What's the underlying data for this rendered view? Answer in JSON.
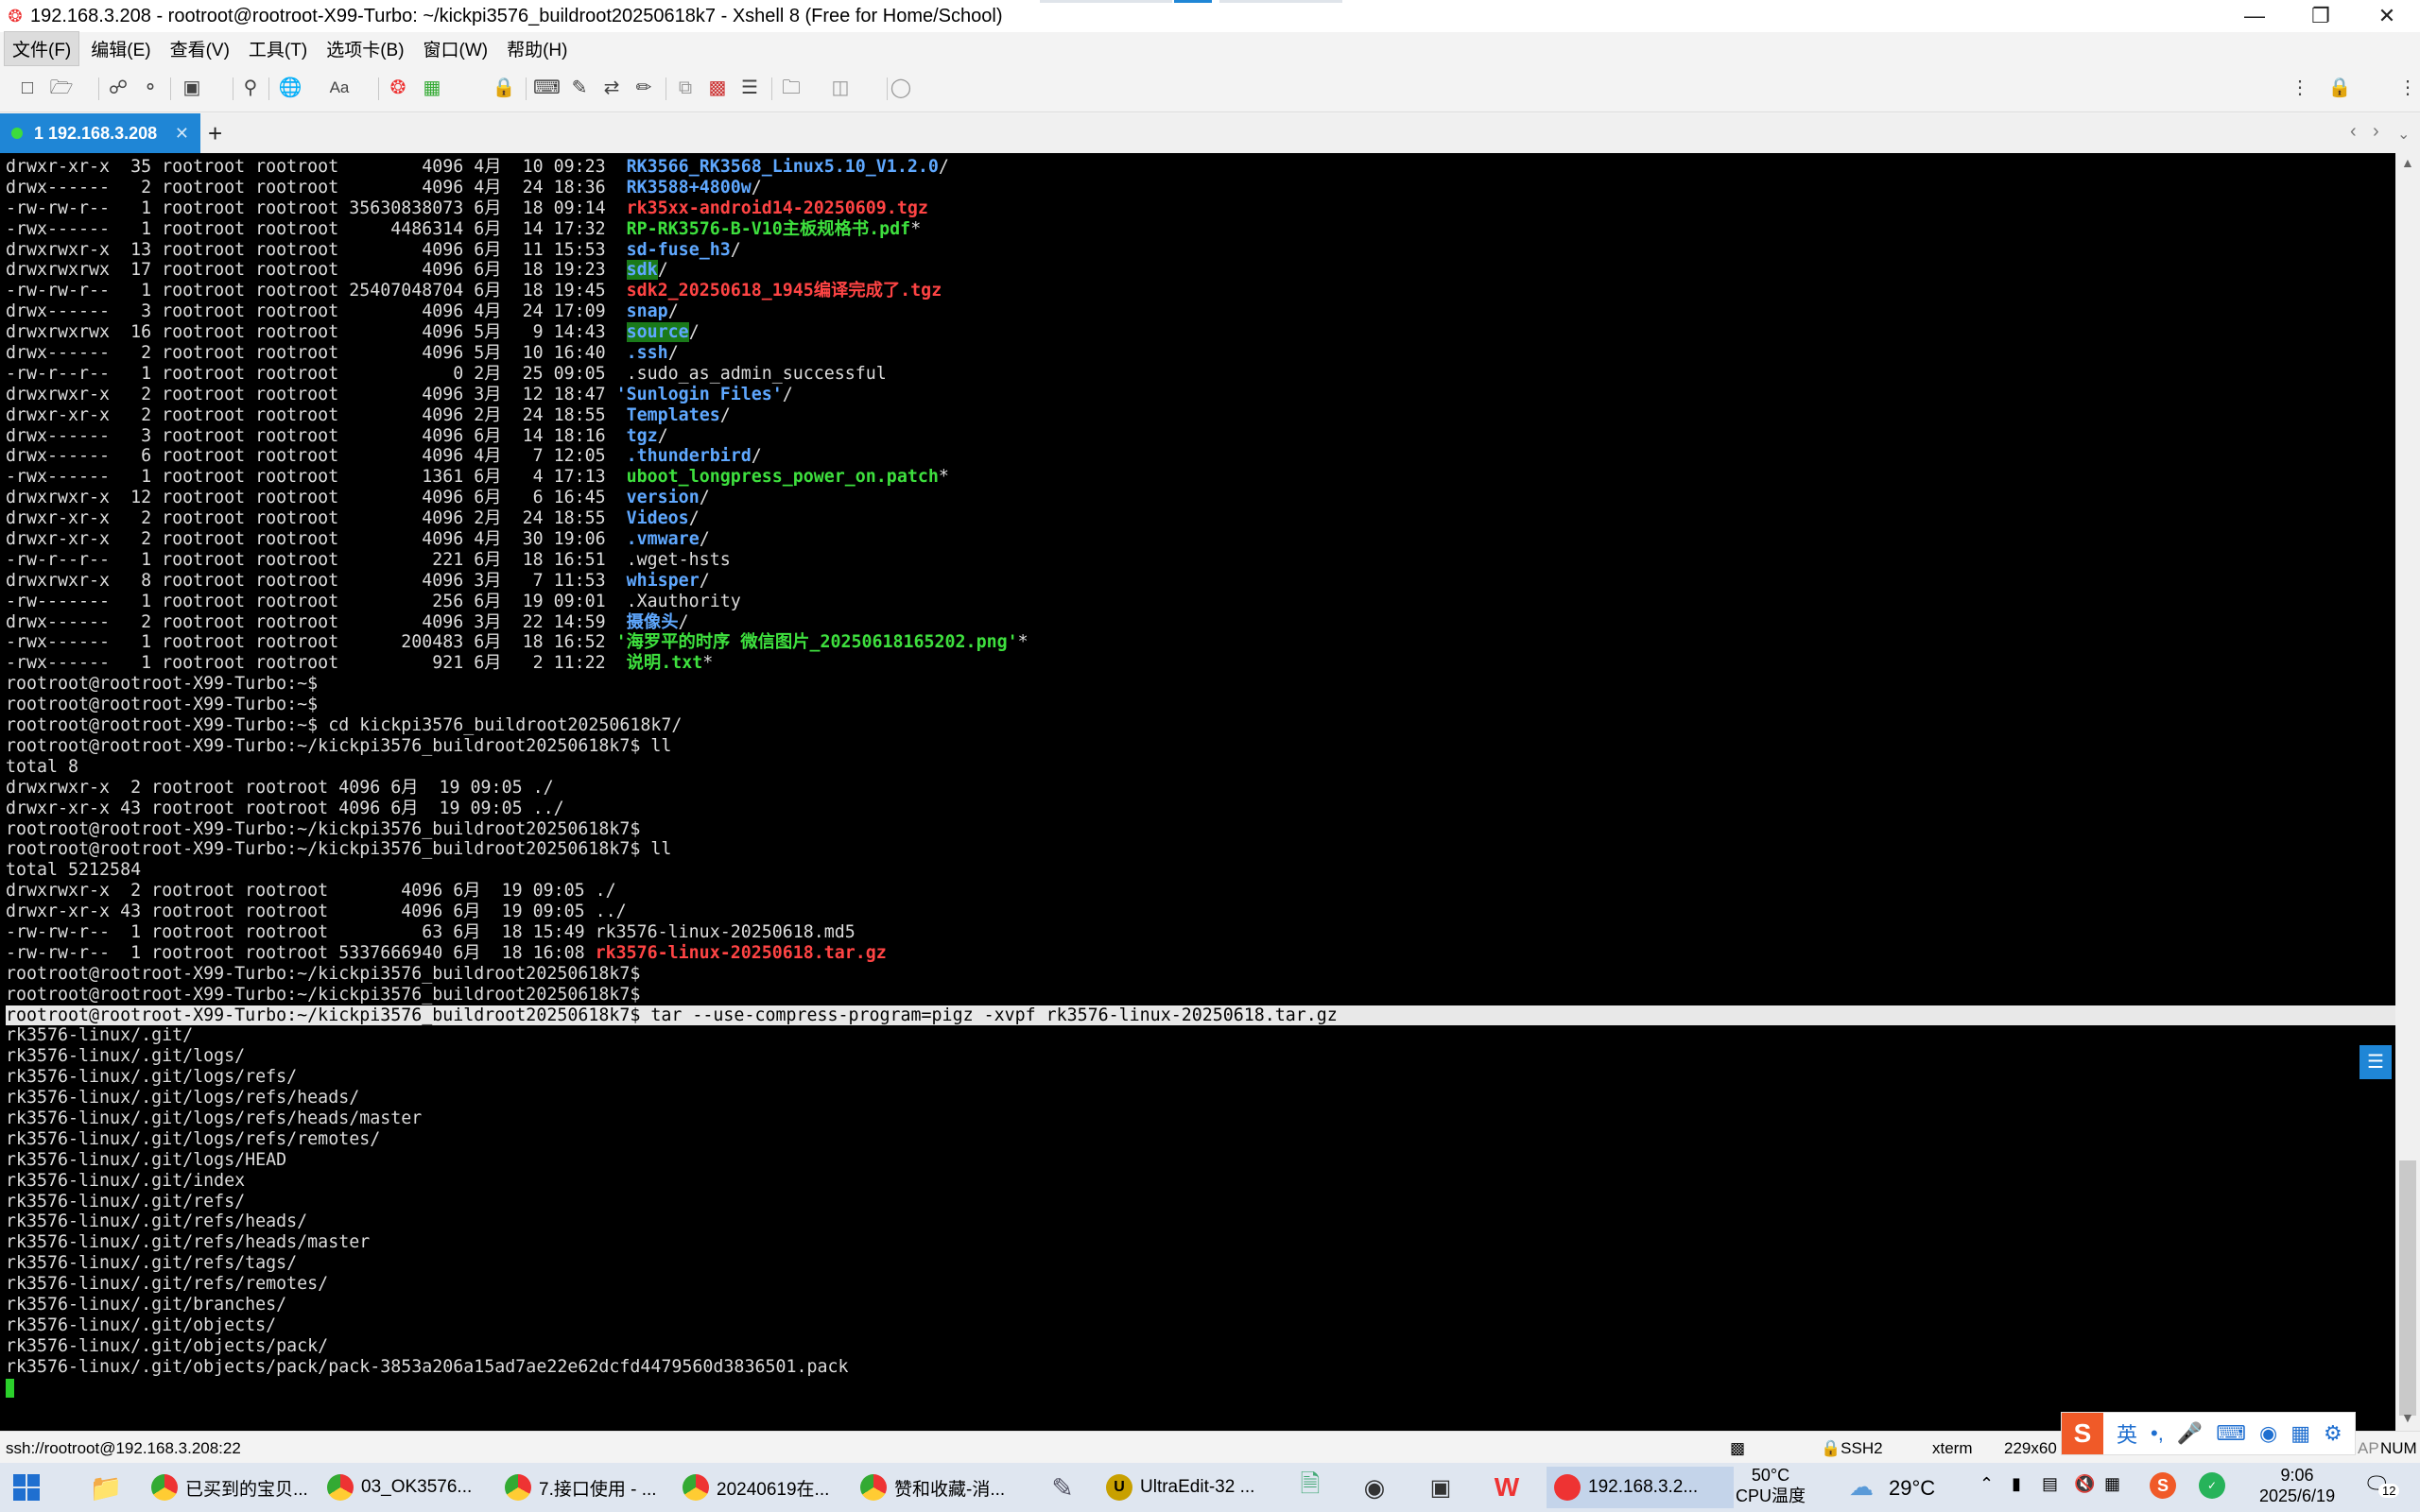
{
  "window": {
    "title": "192.168.3.208 - rootroot@rootroot-X99-Turbo: ~/kickpi3576_buildroot20250618k7 - Xshell 8 (Free for Home/School)",
    "app_icon": "xshell-icon",
    "controls": [
      "minimize-icon",
      "restore-icon",
      "close-icon"
    ]
  },
  "menu": {
    "items": [
      "文件(F)",
      "编辑(E)",
      "查看(V)",
      "工具(T)",
      "选项卡(B)",
      "窗口(W)",
      "帮助(H)"
    ]
  },
  "tabs": {
    "active_label": "1 192.168.3.208",
    "add_label": "+"
  },
  "terminal": {
    "lines": [
      [
        [
          "drwxr-xr-x  35 rootroot rootroot        4096 4月  10 09:23  ",
          "w"
        ],
        [
          "RK3566_RK3568_Linux5.10_V1.2.0",
          "b"
        ],
        [
          "/",
          "w"
        ]
      ],
      [
        [
          "drwx------   2 rootroot rootroot        4096 4月  24 18:36  ",
          "w"
        ],
        [
          "RK3588+4800w",
          "b"
        ],
        [
          "/",
          "w"
        ]
      ],
      [
        [
          "-rw-rw-r--   1 rootroot rootroot 35630838073 6月  18 09:14  ",
          "w"
        ],
        [
          "rk35xx-android14-20250609.tgz",
          "r"
        ]
      ],
      [
        [
          "-rwx------   1 rootroot rootroot     4486314 6月  14 17:32  ",
          "w"
        ],
        [
          "RP-RK3576-B-V10主板规格书.pdf",
          "g"
        ],
        [
          "*",
          "w"
        ]
      ],
      [
        [
          "drwxrwxr-x  13 rootroot rootroot        4096 6月  11 15:53  ",
          "w"
        ],
        [
          "sd-fuse_h3",
          "b"
        ],
        [
          "/",
          "w"
        ]
      ],
      [
        [
          "drwxrwxrwx  17 rootroot rootroot        4096 6月  18 19:23  ",
          "w"
        ],
        [
          "sdk",
          "gb"
        ],
        [
          "/",
          "w"
        ]
      ],
      [
        [
          "-rw-rw-r--   1 rootroot rootroot 25407048704 6月  18 19:45  ",
          "w"
        ],
        [
          "sdk2_20250618_1945编译完成了.tgz",
          "r"
        ]
      ],
      [
        [
          "drwx------   3 rootroot rootroot        4096 4月  24 17:09  ",
          "w"
        ],
        [
          "snap",
          "b"
        ],
        [
          "/",
          "w"
        ]
      ],
      [
        [
          "drwxrwxrwx  16 rootroot rootroot        4096 5月   9 14:43  ",
          "w"
        ],
        [
          "source",
          "gb"
        ],
        [
          "/",
          "w"
        ]
      ],
      [
        [
          "drwx------   2 rootroot rootroot        4096 5月  10 16:40  ",
          "w"
        ],
        [
          ".ssh",
          "b"
        ],
        [
          "/",
          "w"
        ]
      ],
      [
        [
          "-rw-r--r--   1 rootroot rootroot           0 2月  25 09:05  .sudo_as_admin_successful",
          "w"
        ]
      ],
      [
        [
          "drwxrwxr-x   2 rootroot rootroot        4096 3月  12 18:47 ",
          "w"
        ],
        [
          "'Sunlogin Files'",
          "b"
        ],
        [
          "/",
          "w"
        ]
      ],
      [
        [
          "drwxr-xr-x   2 rootroot rootroot        4096 2月  24 18:55  ",
          "w"
        ],
        [
          "Templates",
          "b"
        ],
        [
          "/",
          "w"
        ]
      ],
      [
        [
          "drwx------   3 rootroot rootroot        4096 6月  14 18:16  ",
          "w"
        ],
        [
          "tgz",
          "b"
        ],
        [
          "/",
          "w"
        ]
      ],
      [
        [
          "drwx------   6 rootroot rootroot        4096 4月   7 12:05  ",
          "w"
        ],
        [
          ".thunderbird",
          "b"
        ],
        [
          "/",
          "w"
        ]
      ],
      [
        [
          "-rwx------   1 rootroot rootroot        1361 6月   4 17:13  ",
          "w"
        ],
        [
          "uboot_longpress_power_on.patch",
          "g"
        ],
        [
          "*",
          "w"
        ]
      ],
      [
        [
          "drwxrwxr-x  12 rootroot rootroot        4096 6月   6 16:45  ",
          "w"
        ],
        [
          "version",
          "b"
        ],
        [
          "/",
          "w"
        ]
      ],
      [
        [
          "drwxr-xr-x   2 rootroot rootroot        4096 2月  24 18:55  ",
          "w"
        ],
        [
          "Videos",
          "b"
        ],
        [
          "/",
          "w"
        ]
      ],
      [
        [
          "drwxr-xr-x   2 rootroot rootroot        4096 4月  30 19:06  ",
          "w"
        ],
        [
          ".vmware",
          "b"
        ],
        [
          "/",
          "w"
        ]
      ],
      [
        [
          "-rw-r--r--   1 rootroot rootroot         221 6月  18 16:51  .wget-hsts",
          "w"
        ]
      ],
      [
        [
          "drwxrwxr-x   8 rootroot rootroot        4096 3月   7 11:53  ",
          "w"
        ],
        [
          "whisper",
          "b"
        ],
        [
          "/",
          "w"
        ]
      ],
      [
        [
          "-rw-------   1 rootroot rootroot         256 6月  19 09:01  .Xauthority",
          "w"
        ]
      ],
      [
        [
          "drwx------   2 rootroot rootroot        4096 3月  22 14:59  ",
          "w"
        ],
        [
          "摄像头",
          "b"
        ],
        [
          "/",
          "w"
        ]
      ],
      [
        [
          "-rwx------   1 rootroot rootroot      200483 6月  18 16:52 ",
          "w"
        ],
        [
          "'海罗平的时序 微信图片_20250618165202.png'",
          "g"
        ],
        [
          "*",
          "w"
        ]
      ],
      [
        [
          "-rwx------   1 rootroot rootroot         921 6月   2 11:22  ",
          "w"
        ],
        [
          "说明.txt",
          "g"
        ],
        [
          "*",
          "w"
        ]
      ],
      [
        [
          "rootroot@rootroot-X99-Turbo:~$",
          "w"
        ]
      ],
      [
        [
          "rootroot@rootroot-X99-Turbo:~$",
          "w"
        ]
      ],
      [
        [
          "rootroot@rootroot-X99-Turbo:~$ cd kickpi3576_buildroot20250618k7/",
          "w"
        ]
      ],
      [
        [
          "rootroot@rootroot-X99-Turbo:~/kickpi3576_buildroot20250618k7$ ll",
          "w"
        ]
      ],
      [
        [
          "total 8",
          "w"
        ]
      ],
      [
        [
          "drwxrwxr-x  2 rootroot rootroot 4096 6月  19 09:05 ./",
          "w"
        ]
      ],
      [
        [
          "drwxr-xr-x 43 rootroot rootroot 4096 6月  19 09:05 ../",
          "w"
        ]
      ],
      [
        [
          "rootroot@rootroot-X99-Turbo:~/kickpi3576_buildroot20250618k7$",
          "w"
        ]
      ],
      [
        [
          "rootroot@rootroot-X99-Turbo:~/kickpi3576_buildroot20250618k7$ ll",
          "w"
        ]
      ],
      [
        [
          "total 5212584",
          "w"
        ]
      ],
      [
        [
          "drwxrwxr-x  2 rootroot rootroot       4096 6月  19 09:05 ./",
          "w"
        ]
      ],
      [
        [
          "drwxr-xr-x 43 rootroot rootroot       4096 6月  19 09:05 ../",
          "w"
        ]
      ],
      [
        [
          "-rw-rw-r--  1 rootroot rootroot         63 6月  18 15:49 rk3576-linux-20250618.md5",
          "w"
        ]
      ],
      [
        [
          "-rw-rw-r--  1 rootroot rootroot 5337666940 6月  18 16:08 ",
          "w"
        ],
        [
          "rk3576-linux-20250618.tar.gz",
          "r"
        ]
      ],
      [
        [
          "rootroot@rootroot-X99-Turbo:~/kickpi3576_buildroot20250618k7$",
          "w"
        ]
      ],
      [
        [
          "rootroot@rootroot-X99-Turbo:~/kickpi3576_buildroot20250618k7$",
          "w"
        ]
      ],
      [
        [
          "rootroot@rootroot-X99-Turbo:~/kickpi3576_buildroot20250618k7$ tar --use-compress-program=pigz -xvpf rk3576-linux-20250618.tar.gz",
          "hl"
        ]
      ],
      [
        [
          "rk3576-linux/.git/",
          "w"
        ]
      ],
      [
        [
          "rk3576-linux/.git/logs/",
          "w"
        ]
      ],
      [
        [
          "rk3576-linux/.git/logs/refs/",
          "w"
        ]
      ],
      [
        [
          "rk3576-linux/.git/logs/refs/heads/",
          "w"
        ]
      ],
      [
        [
          "rk3576-linux/.git/logs/refs/heads/master",
          "w"
        ]
      ],
      [
        [
          "rk3576-linux/.git/logs/refs/remotes/",
          "w"
        ]
      ],
      [
        [
          "rk3576-linux/.git/logs/HEAD",
          "w"
        ]
      ],
      [
        [
          "rk3576-linux/.git/index",
          "w"
        ]
      ],
      [
        [
          "rk3576-linux/.git/refs/",
          "w"
        ]
      ],
      [
        [
          "rk3576-linux/.git/refs/heads/",
          "w"
        ]
      ],
      [
        [
          "rk3576-linux/.git/refs/heads/master",
          "w"
        ]
      ],
      [
        [
          "rk3576-linux/.git/refs/tags/",
          "w"
        ]
      ],
      [
        [
          "rk3576-linux/.git/refs/remotes/",
          "w"
        ]
      ],
      [
        [
          "rk3576-linux/.git/branches/",
          "w"
        ]
      ],
      [
        [
          "rk3576-linux/.git/objects/",
          "w"
        ]
      ],
      [
        [
          "rk3576-linux/.git/objects/pack/",
          "w"
        ]
      ],
      [
        [
          "rk3576-linux/.git/objects/pack/pack-3853a206a15ad7ae22e62dcfd4479560d3836501.pack",
          "w"
        ]
      ]
    ]
  },
  "status": {
    "connection": "ssh://rootroot@192.168.3.208:22",
    "protocol": "SSH2",
    "term_type": "xterm",
    "size": "229x60",
    "mode": "NUM",
    "cap": "AP"
  },
  "ime": {
    "lang": "英",
    "punct": "•,"
  },
  "taskbar": {
    "items": [
      {
        "label": "已买到的宝贝...",
        "icon": "chrome-icon"
      },
      {
        "label": "03_OK3576...",
        "icon": "chrome-icon"
      },
      {
        "label": "7.接口使用 - ...",
        "icon": "chrome-icon"
      },
      {
        "label": "20240619在...",
        "icon": "chrome-icon"
      },
      {
        "label": "赞和收藏-消...",
        "icon": "chrome-icon"
      },
      {
        "label": "UltraEdit-32 ...",
        "icon": "ultraedit-icon"
      },
      {
        "label": "192.168.3.2...",
        "icon": "xshell-icon"
      }
    ],
    "cpu_temp": "50°C",
    "cpu_label": "CPU温度",
    "weather_temp": "29°C",
    "time": "9:06",
    "date": "2025/6/19",
    "notifications": "12"
  }
}
